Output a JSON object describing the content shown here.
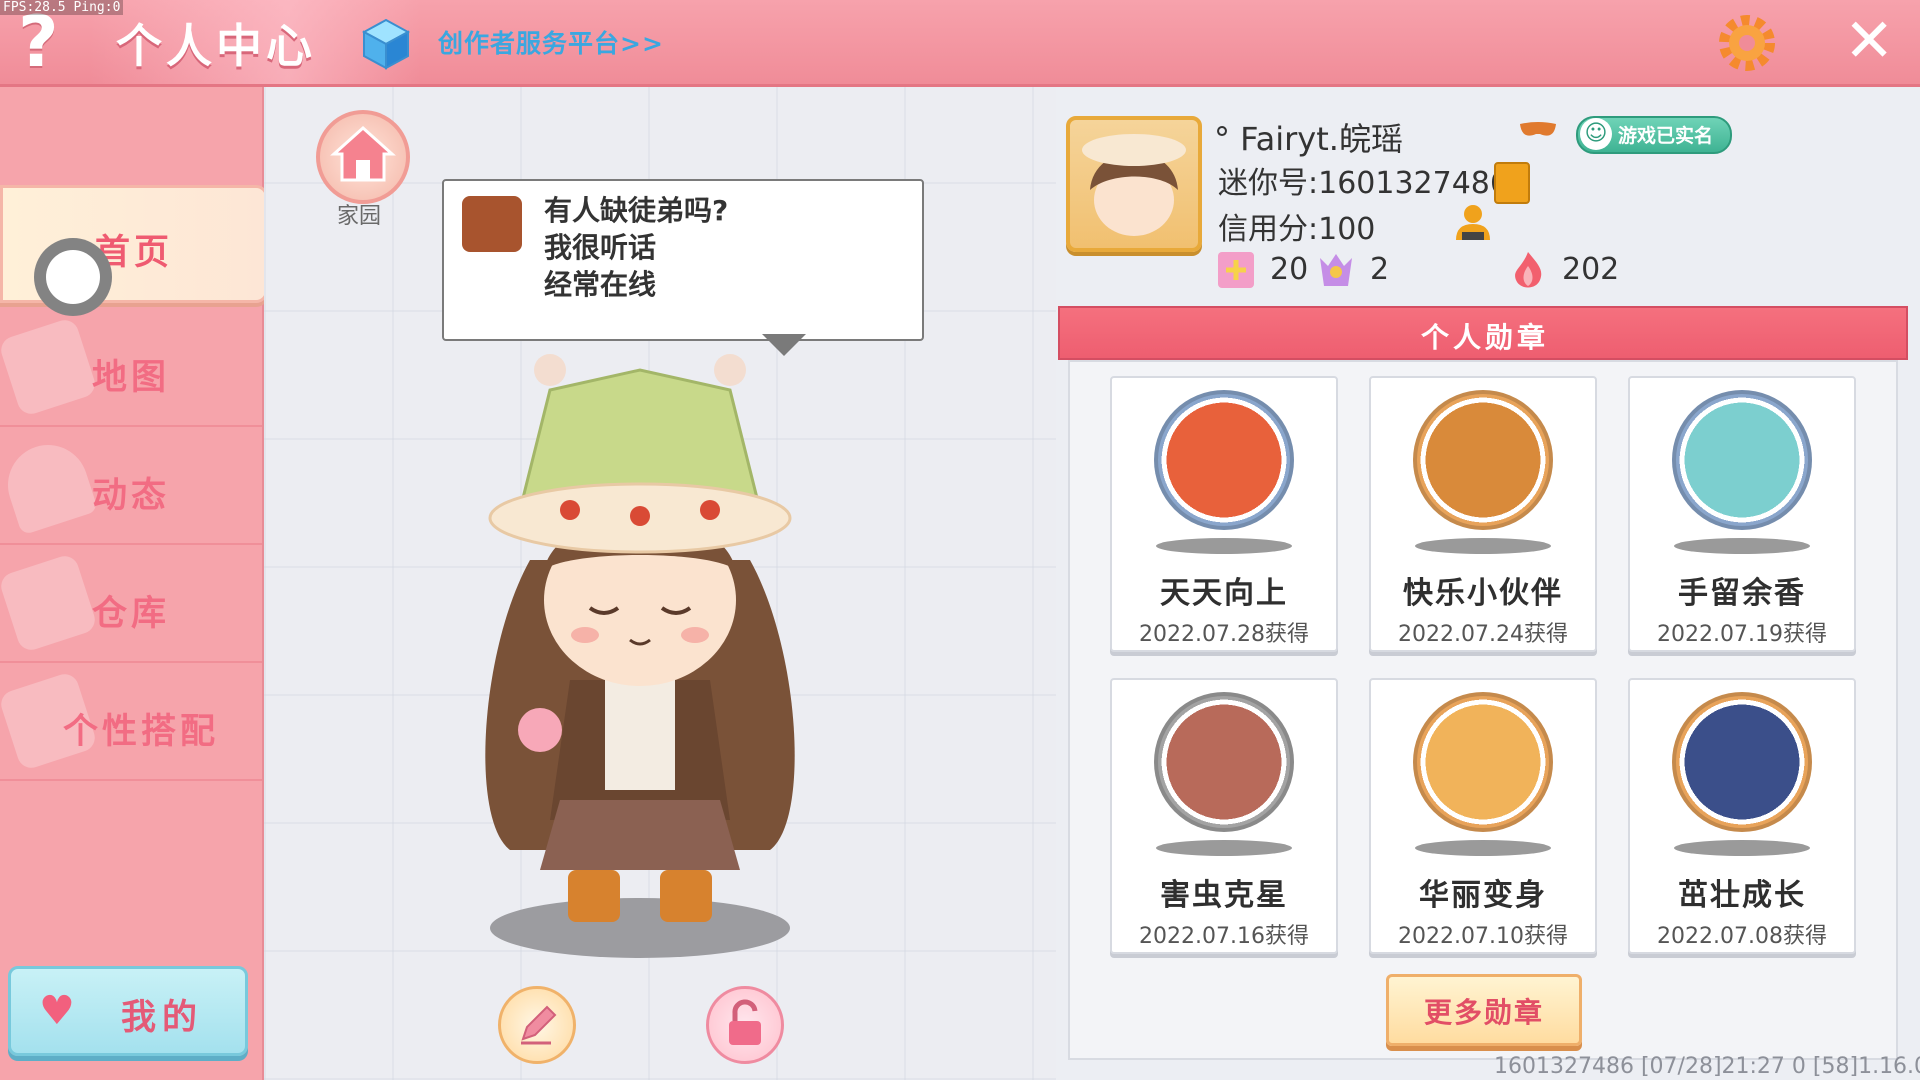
{
  "debug": {
    "fps": "FPS:28.5  Ping:0"
  },
  "header": {
    "help_label": "?",
    "title": "个人中心",
    "creator_link": "创作者服务平台>>",
    "close_label": "✕"
  },
  "sidebar": {
    "items": [
      {
        "label": "首页",
        "active": true
      },
      {
        "label": "地图"
      },
      {
        "label": "动态"
      },
      {
        "label": "仓库"
      },
      {
        "label": "个性搭配"
      }
    ],
    "my_button": "我的"
  },
  "scene": {
    "home_label": "家园",
    "speech": [
      "有人缺徒弟吗?",
      "我很听话",
      "经常在线"
    ]
  },
  "profile": {
    "nickname": "° Fairyt.皖瑶",
    "mini_id": "迷你号:1601327486",
    "credit": "信用分:100",
    "verified": "游戏已实名",
    "stats": [
      {
        "icon": "add-friend-icon",
        "value": "20"
      },
      {
        "icon": "fans-icon",
        "value": "2"
      },
      {
        "icon": "flame-icon",
        "value": "202"
      }
    ]
  },
  "medals": {
    "header": "个人勋章",
    "items": [
      {
        "name": "天天向上",
        "date": "2022.07.28获得",
        "color": "#e8613b",
        "ring": "#8aa6cc"
      },
      {
        "name": "快乐小伙伴",
        "date": "2022.07.24获得",
        "color": "#d98a3a",
        "ring": "#e8a35a"
      },
      {
        "name": "手留余香",
        "date": "2022.07.19获得",
        "color": "#7ccfcf",
        "ring": "#8aa6cc"
      },
      {
        "name": "害虫克星",
        "date": "2022.07.16获得",
        "color": "#b86a5a",
        "ring": "#a3a3a3"
      },
      {
        "name": "华丽变身",
        "date": "2022.07.10获得",
        "color": "#f1b35a",
        "ring": "#e8a35a"
      },
      {
        "name": "茁壮成长",
        "date": "2022.07.08获得",
        "color": "#3b4f8a",
        "ring": "#e8a35a"
      }
    ],
    "more_button": "更多勋章"
  },
  "footer": "1601327486   [07/28]21:27 0  [58]1.16.0"
}
